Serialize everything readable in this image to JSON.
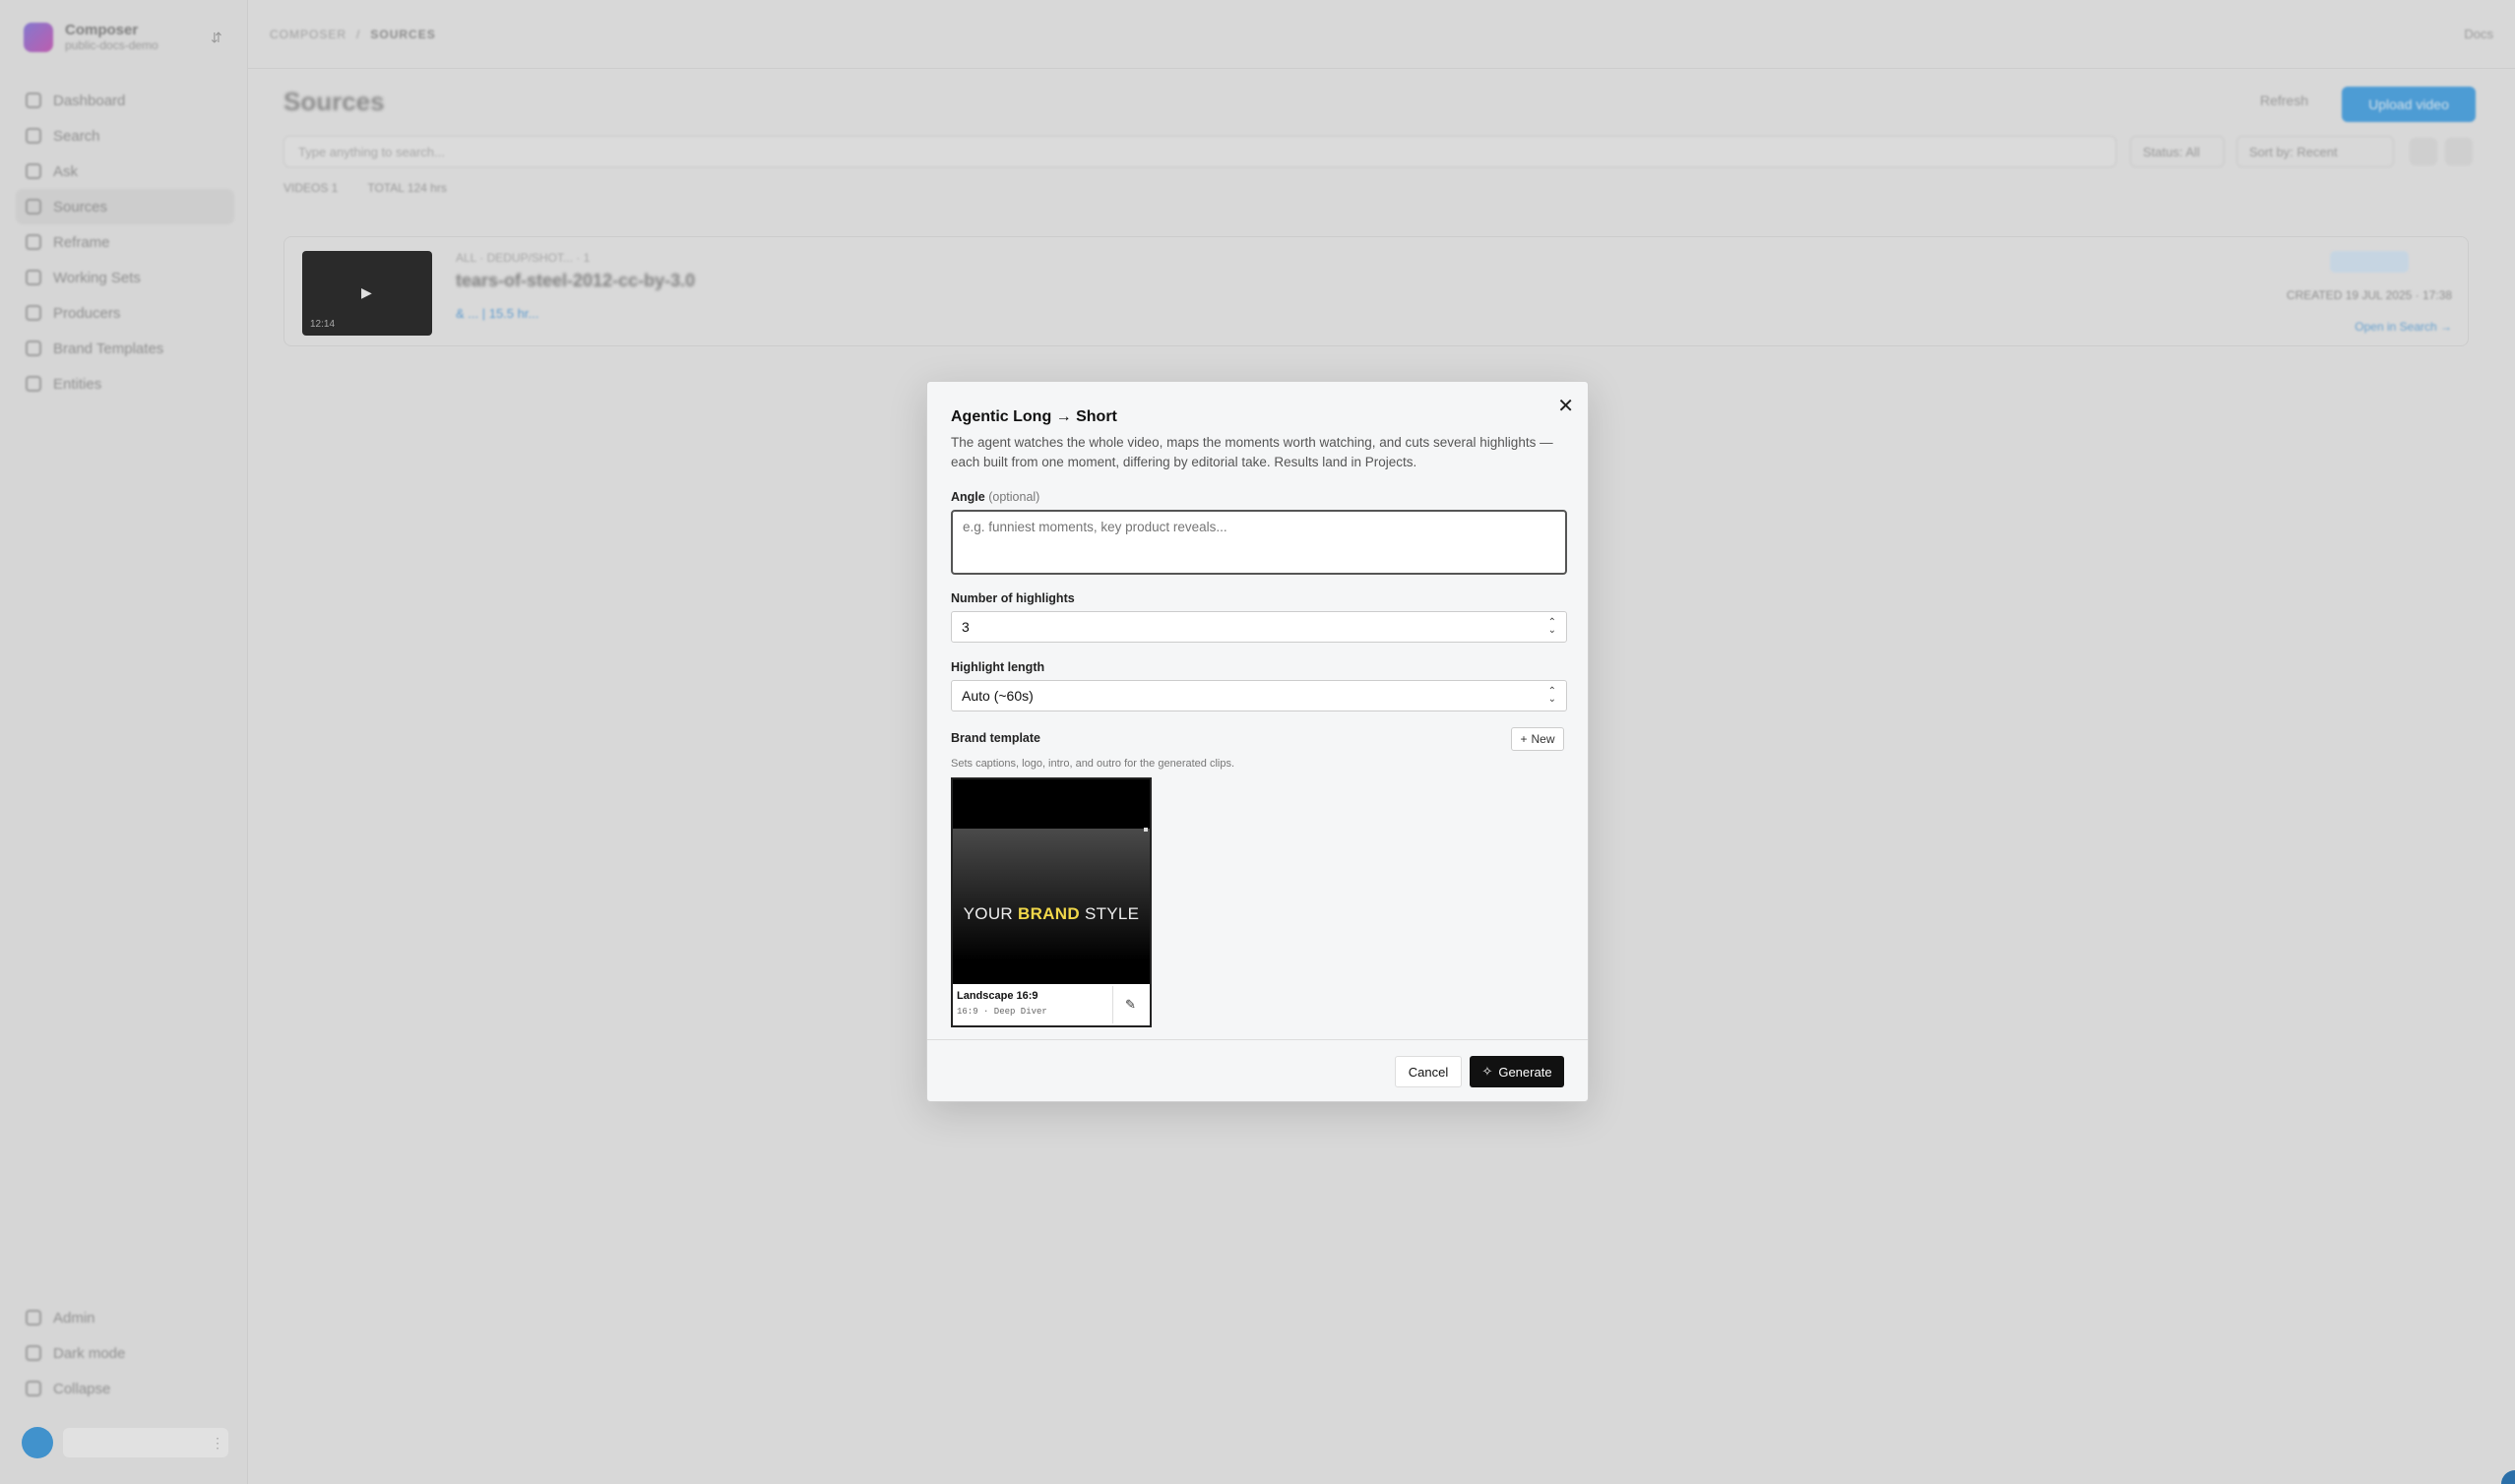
{
  "sidebar": {
    "workspace_name": "Composer",
    "workspace_sub": "public-docs-demo",
    "toggle_icon": "⇵",
    "items": [
      {
        "label": "Dashboard",
        "icon": "grid-icon"
      },
      {
        "label": "Search",
        "icon": "search-icon"
      },
      {
        "label": "Ask",
        "icon": "chat-icon"
      },
      {
        "label": "Sources",
        "icon": "database-icon",
        "active": true
      },
      {
        "label": "Reframe",
        "icon": "crop-icon"
      },
      {
        "label": "Working Sets",
        "icon": "layers-icon"
      },
      {
        "label": "Producers",
        "icon": "sparkle-icon"
      },
      {
        "label": "Brand Templates",
        "icon": "palette-icon"
      },
      {
        "label": "Entities",
        "icon": "tag-icon"
      }
    ],
    "bottom_items": [
      {
        "label": "Admin",
        "icon": "settings-icon"
      },
      {
        "label": "Dark mode",
        "icon": "moon-icon"
      },
      {
        "label": "Collapse",
        "icon": "collapse-icon"
      }
    ],
    "user_menu": "⋮"
  },
  "topbar": {
    "breadcrumb": [
      "COMPOSER",
      "SOURCES"
    ],
    "breadcrumb_sep": "/",
    "docs": "Docs"
  },
  "page": {
    "title": "Sources",
    "refresh": "Refresh",
    "upload": "Upload video",
    "search_placeholder": "Type anything to search...",
    "status_label": "Status: All",
    "sort_label": "Sort by: Recent",
    "stats_videos": "VIDEOS 1",
    "stats_total": "TOTAL 124 hrs"
  },
  "card": {
    "meta": "ALL · DEDUP/SHOT... · 1",
    "title": "tears-of-steel-2012-cc-by-3.0",
    "link": "& ... | 15.5 hr...",
    "duration": "12:14",
    "date": "CREATED  19 JUL 2025 · 17:38",
    "open": "Open in Search →"
  },
  "modal": {
    "title": "Agentic Long → Short",
    "description": "The agent watches the whole video, maps the moments worth watching, and cuts several highlights — each built from one moment, differing by editorial take. Results land in Projects.",
    "angle_label": "Angle",
    "angle_optional": "(optional)",
    "angle_placeholder": "e.g. funniest moments, key product reveals...",
    "highlights_label": "Number of highlights",
    "highlights_value": "3",
    "length_label": "Highlight length",
    "length_value": "Auto (~60s)",
    "brand_label": "Brand template",
    "brand_help": "Sets captions, logo, intro, and outro for the generated clips.",
    "new_button": "New",
    "template": {
      "preview_text_a": "YOUR",
      "preview_text_b": "BRAND",
      "preview_text_c": "STYLE",
      "name": "Landscape 16:9",
      "sub": "16:9 · Deep Diver",
      "highlight_color": "#f1d84a"
    },
    "cancel": "Cancel",
    "generate": "Generate"
  }
}
